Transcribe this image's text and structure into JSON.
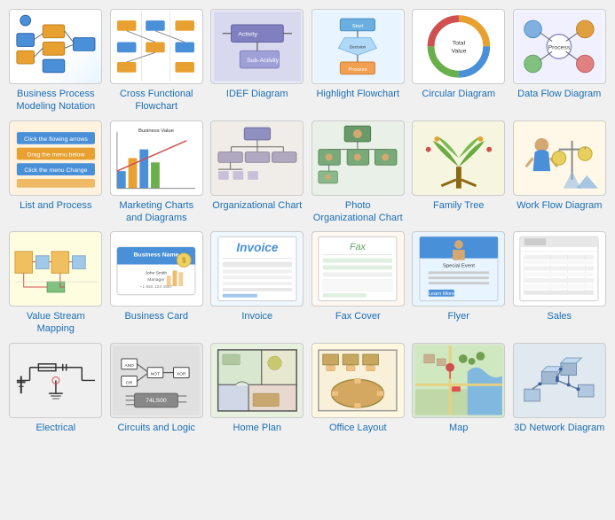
{
  "items": [
    {
      "id": "bp",
      "label": "Business Process\nModeling Notation",
      "bg": "t-bp"
    },
    {
      "id": "cf",
      "label": "Cross Functional\nFlowchart",
      "bg": "t-cf"
    },
    {
      "id": "idef",
      "label": "IDEF Diagram",
      "bg": "t-idef"
    },
    {
      "id": "hl",
      "label": "Highlight Flowchart",
      "bg": "t-hl"
    },
    {
      "id": "circ",
      "label": "Circular Diagram",
      "bg": "t-circ"
    },
    {
      "id": "df",
      "label": "Data Flow Diagram",
      "bg": "t-df"
    },
    {
      "id": "lp",
      "label": "List and Process",
      "bg": "t-lp"
    },
    {
      "id": "mc",
      "label": "Marketing Charts\nand Diagrams",
      "bg": "t-mc"
    },
    {
      "id": "oc",
      "label": "Organizational Chart",
      "bg": "t-oc"
    },
    {
      "id": "poc",
      "label": "Photo\nOrganizational Chart",
      "bg": "t-poc"
    },
    {
      "id": "ft",
      "label": "Family Tree",
      "bg": "t-ft"
    },
    {
      "id": "wf",
      "label": "Work Flow Diagram",
      "bg": "t-wf"
    },
    {
      "id": "vs",
      "label": "Value Stream\nMapping",
      "bg": "t-vs"
    },
    {
      "id": "bc",
      "label": "Business Card",
      "bg": "t-bc"
    },
    {
      "id": "inv",
      "label": "Invoice",
      "bg": "t-inv"
    },
    {
      "id": "fax",
      "label": "Fax Cover",
      "bg": "t-fax"
    },
    {
      "id": "fly",
      "label": "Flyer",
      "bg": "t-fly"
    },
    {
      "id": "sal",
      "label": "Sales",
      "bg": "t-sal"
    },
    {
      "id": "el",
      "label": "Electrical",
      "bg": "t-el"
    },
    {
      "id": "cl",
      "label": "Circuits and Logic",
      "bg": "t-cl"
    },
    {
      "id": "hp",
      "label": "Home Plan",
      "bg": "t-hp"
    },
    {
      "id": "ol",
      "label": "Office Layout",
      "bg": "t-ol"
    },
    {
      "id": "map",
      "label": "Map",
      "bg": "t-map"
    },
    {
      "id": "3d",
      "label": "3D Network Diagram",
      "bg": "t-3d"
    }
  ]
}
